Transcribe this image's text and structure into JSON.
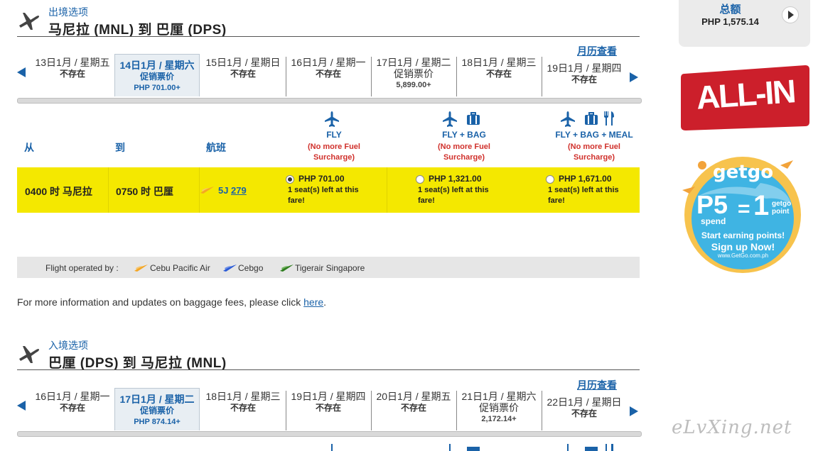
{
  "outbound": {
    "section_label": "出境选项",
    "route": "马尼拉 (MNL) 到 巴厘 (DPS)",
    "calendar_link": "月历查看",
    "dates": [
      {
        "date": "13日1月 / 星期五",
        "status": "不存在",
        "price": ""
      },
      {
        "date": "14日1月 / 星期六",
        "status": "促销票价",
        "price": "PHP 701.00+"
      },
      {
        "date": "15日1月 / 星期日",
        "status": "不存在",
        "price": ""
      },
      {
        "date": "16日1月 / 星期一",
        "status": "不存在",
        "price": ""
      },
      {
        "date": "17日1月 / 星期二",
        "status": "促销票价",
        "price": "5,899.00+"
      },
      {
        "date": "18日1月 / 星期三",
        "status": "不存在",
        "price": ""
      },
      {
        "date": "19日1月 / 星期四",
        "status": "不存在",
        "price": ""
      }
    ],
    "headers": {
      "from": "从",
      "to": "到",
      "flight": "航班"
    },
    "fares": [
      {
        "title": "FLY",
        "sub1": "(No more Fuel",
        "sub2": "Surcharge)"
      },
      {
        "title": "FLY + BAG",
        "sub1": "(No more Fuel",
        "sub2": "Surcharge)"
      },
      {
        "title": "FLY + BAG + MEAL",
        "sub1": "(No more Fuel",
        "sub2": "Surcharge)"
      }
    ],
    "flight_row": {
      "depart": "0400 时  马尼拉",
      "arrive": "0750 时  巴厘",
      "carrier": "5J",
      "number": "279",
      "options": [
        {
          "price": "PHP 701.00",
          "seat1": "1 seat(s) left at this",
          "seat2": "fare!",
          "selected": true
        },
        {
          "price": "PHP 1,321.00",
          "seat1": "1 seat(s) left at this",
          "seat2": "fare!",
          "selected": false
        },
        {
          "price": "PHP 1,671.00",
          "seat1": "1 seat(s) left at this",
          "seat2": "fare!",
          "selected": false
        }
      ]
    },
    "operated": {
      "label": "Flight operated by :",
      "airlines": [
        "Cebu Pacific Air",
        "Cebgo",
        "Tigerair Singapore"
      ]
    },
    "note_text": "For more information and updates on baggage fees, please click ",
    "note_link": "here",
    "note_end": "."
  },
  "inbound": {
    "section_label": "入境选项",
    "route": "巴厘 (DPS) 到 马尼拉 (MNL)",
    "calendar_link": "月历查看",
    "dates": [
      {
        "date": "16日1月 / 星期一",
        "status": "不存在",
        "price": ""
      },
      {
        "date": "17日1月 / 星期二",
        "status": "促销票价",
        "price": "PHP 874.14+"
      },
      {
        "date": "18日1月 / 星期三",
        "status": "不存在",
        "price": ""
      },
      {
        "date": "19日1月 / 星期四",
        "status": "不存在",
        "price": ""
      },
      {
        "date": "20日1月 / 星期五",
        "status": "不存在",
        "price": ""
      },
      {
        "date": "21日1月 / 星期六",
        "status": "促销票价",
        "price": "2,172.14+"
      },
      {
        "date": "22日1月 / 星期日",
        "status": "不存在",
        "price": ""
      }
    ]
  },
  "summary": {
    "title": "总额",
    "amount": "PHP  1,575.14"
  },
  "ads": {
    "allin": "ALL-IN",
    "getgo_logo": "getgo",
    "getgo_p5": "P5",
    "getgo_spend": "spend",
    "getgo_eq": "=",
    "getgo_1": "1",
    "getgo_point1": "getgo",
    "getgo_point2": "point",
    "getgo_line1": "Start earning points!",
    "getgo_line2": "Sign up Now!",
    "getgo_url": "www.GetGo.com.ph"
  },
  "watermark": "eLvXing.net",
  "colors": {
    "accent": "#1a62a8",
    "highlight": "#f4e800",
    "alert": "#d0302b"
  }
}
